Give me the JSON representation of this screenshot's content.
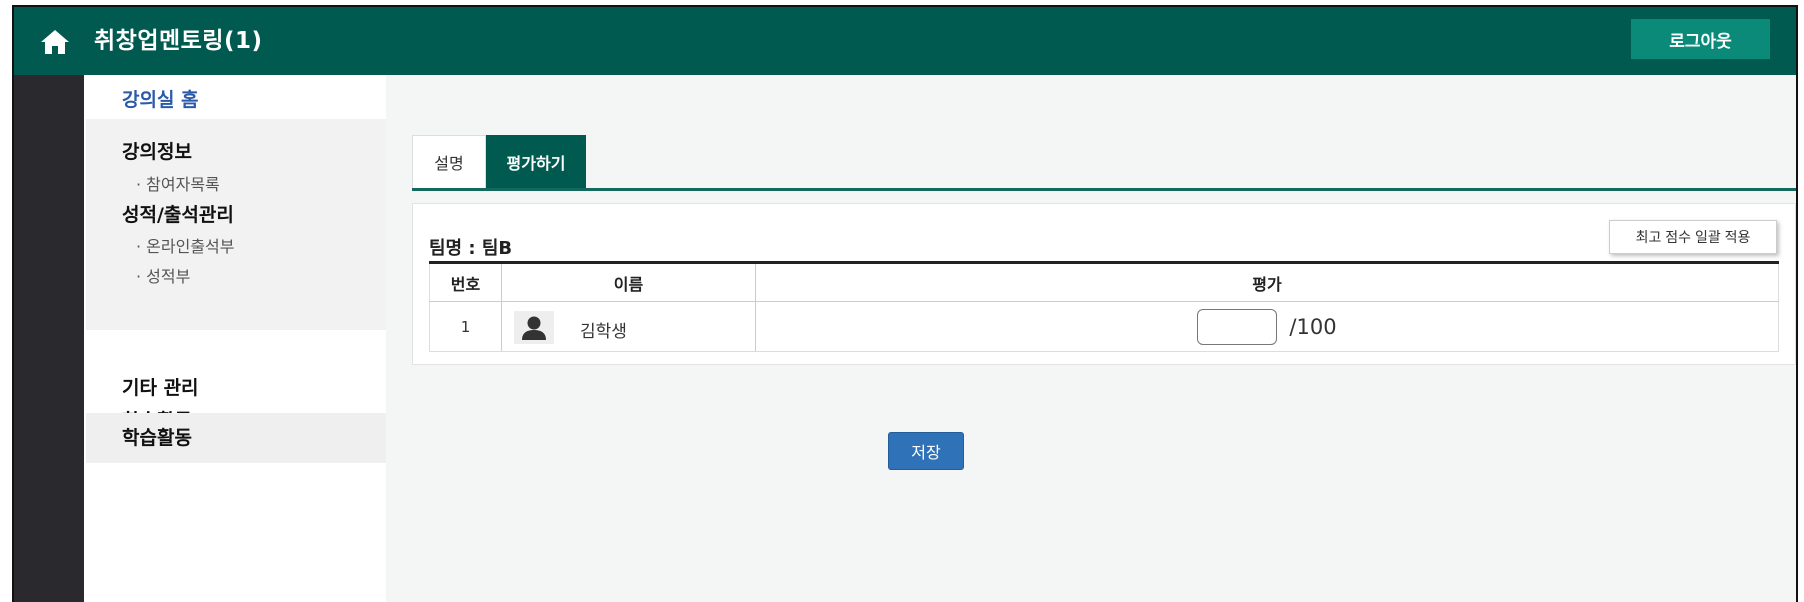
{
  "header": {
    "title": "취창업멘토링(1)",
    "home_icon": "home-icon",
    "logout_label": "로그아웃"
  },
  "sidebar": {
    "home_label": "강의실 홈",
    "course_info": "강의정보",
    "participants": "· 참여자목록",
    "grades_attendance": "성적/출석관리",
    "online_attendance": "· 온라인출석부",
    "gradebook": "· 성적부",
    "other_manage": "기타 관리",
    "learning_activity": "학습활동",
    "learning_activity_active": "학습활동"
  },
  "tabs": {
    "description": "설명",
    "evaluate": "평가하기"
  },
  "panel": {
    "team_label": "팀명 : 팀B",
    "bulk_button": "최고 점수 일괄 적용",
    "columns": {
      "number": "번호",
      "name": "이름",
      "evaluation": "평가"
    },
    "rows": [
      {
        "number": "1",
        "name": "김학생",
        "score": "",
        "max": "/100"
      }
    ]
  },
  "save_label": "저장",
  "colors": {
    "header_bg": "#005a50",
    "logout_bg": "#0b8a7a",
    "save_bg": "#2f72b8",
    "active_link": "#2a5aa8"
  }
}
